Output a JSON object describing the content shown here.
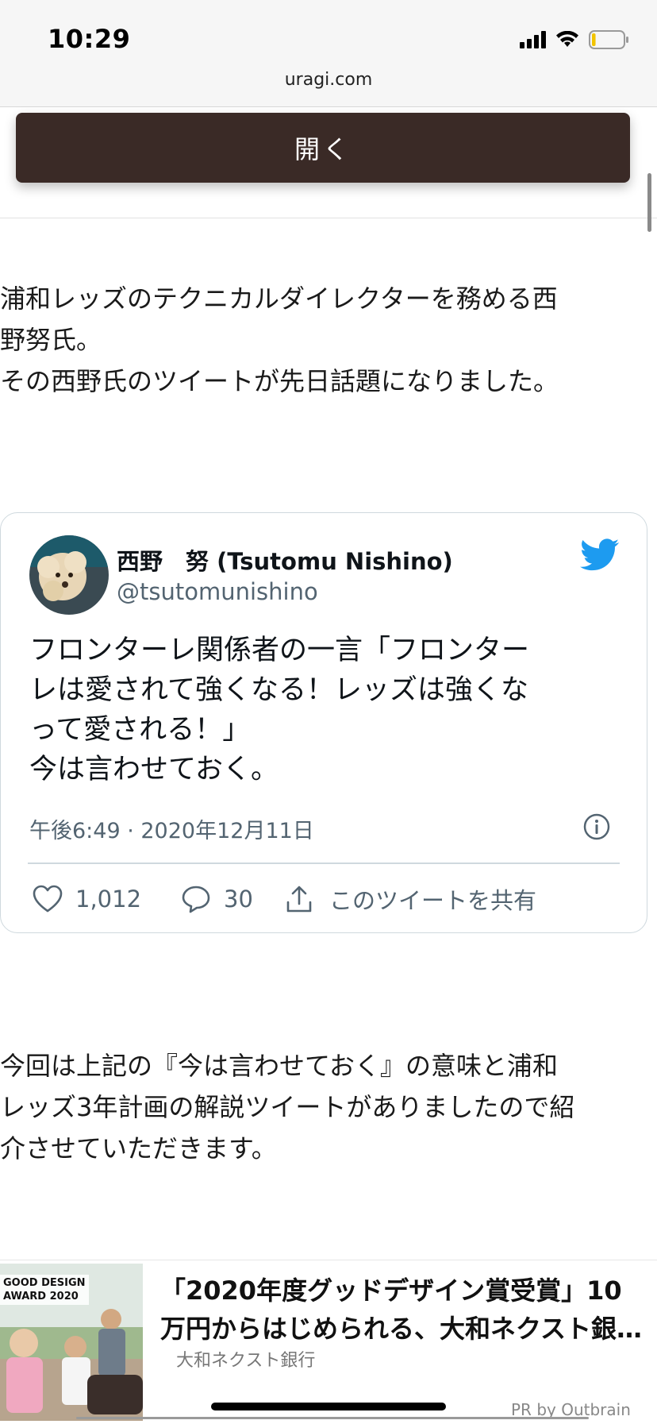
{
  "status_bar": {
    "time": "10:29",
    "battery_level": 0.12
  },
  "browser": {
    "url": "uragi.com"
  },
  "open_button": {
    "label": "開く"
  },
  "intro": [
    "浦和レッズのテクニカルダイレクターを務める西",
    "野努氏。",
    "その西野氏のツイートが先日話題になりました。"
  ],
  "tweet": {
    "name": "西野　努 (Tsutomu Nishino)",
    "handle": "@tsutomunishino",
    "lines": [
      "フロンターレ関係者の一言「フロンター",
      "レは愛されて強くなる！レッズは強くな",
      "って愛される！」",
      "今は言わせておく。"
    ],
    "date": "午後6:49 · 2020年12月11日",
    "likes": "1,012",
    "replies": "30",
    "share_label": "このツイートを共有",
    "brand_color": "#1d9bf0"
  },
  "outro": [
    "今回は上記の『今は言わせておく』の意味と浦和",
    "レッズ3年計画の解説ツイートがありましたので紹",
    "介させていただきます。"
  ],
  "ad": {
    "badge_line1": "GOOD DESIGN",
    "badge_line2": "AWARD 2020",
    "title_line1": "「2020年度グッドデザイン賞受賞」10",
    "title_line2": "万円からはじめられる、大和ネクスト銀…",
    "source": "大和ネクスト銀行",
    "pr": "PR by Outbrain"
  }
}
